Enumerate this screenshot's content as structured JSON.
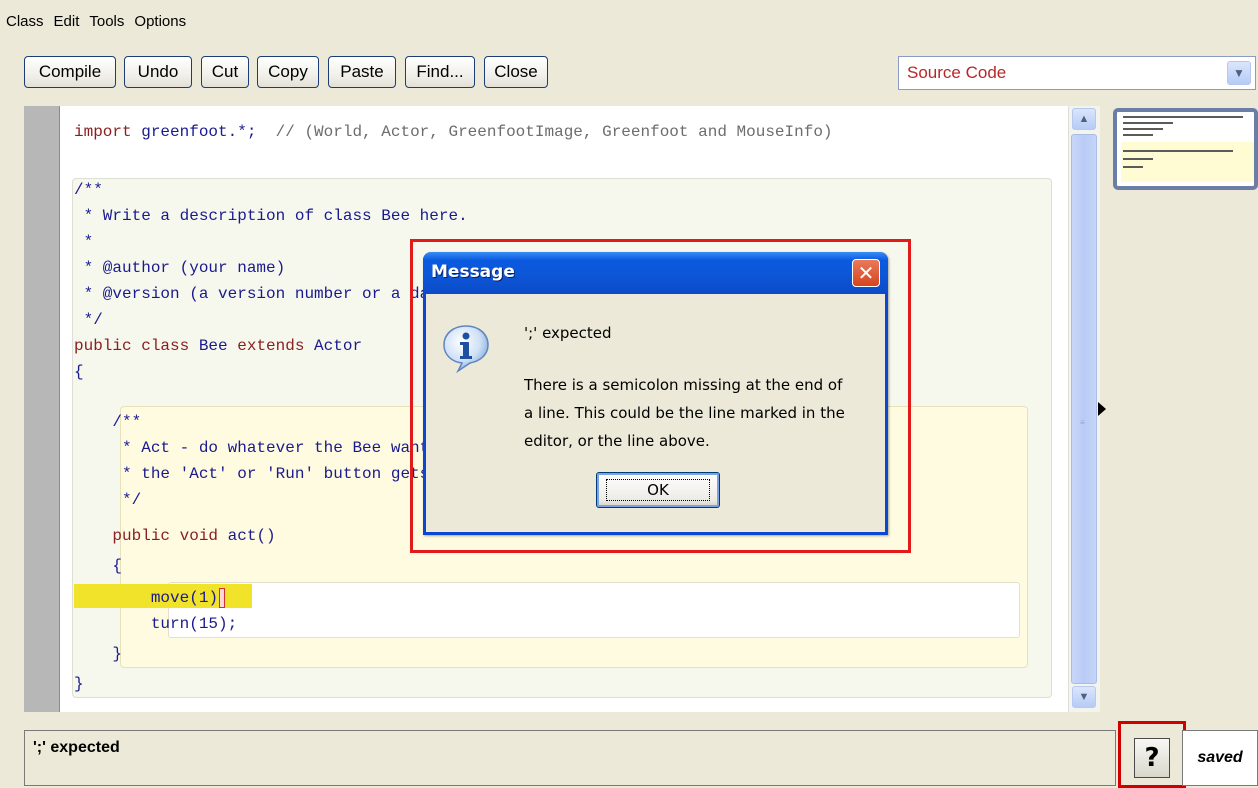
{
  "menu": [
    "Class",
    "Edit",
    "Tools",
    "Options"
  ],
  "toolbar": {
    "buttons": [
      "Compile",
      "Undo",
      "Cut",
      "Copy",
      "Paste",
      "Find...",
      "Close"
    ],
    "view_select": "Source Code"
  },
  "code_lines": [
    {
      "text": "import greenfoot.*;  // (World, Actor, GreenfootImage, Greenfoot and MouseInfo)"
    },
    {
      "text": "/**"
    },
    {
      "text": " * Write a description of class Bee here."
    },
    {
      "text": " *"
    },
    {
      "text": " * @author (your name)"
    },
    {
      "text": " * @version (a version number or a date)"
    },
    {
      "text": " */"
    },
    {
      "text": "public class Bee extends Actor"
    },
    {
      "text": "{"
    },
    {
      "text": "    /**"
    },
    {
      "text": "     * Act - do whatever the Bee wants to do. This method is called whenever"
    },
    {
      "text": "     * the 'Act' or 'Run' button gets pressed in the environment."
    },
    {
      "text": "     */"
    },
    {
      "text": "    public void act()"
    },
    {
      "text": "    {"
    },
    {
      "text": "        move(1)"
    },
    {
      "text": "        turn(15);"
    },
    {
      "text": "    }"
    },
    {
      "text": "}"
    }
  ],
  "dialog": {
    "title": "Message",
    "close_label": "✕",
    "message_heading": "';' expected",
    "message_lines": [
      "There is a semicolon missing at the end of",
      "a line. This could be the line marked in the",
      "editor, or the line above."
    ],
    "ok_label": "OK"
  },
  "status": {
    "message": "';' expected",
    "help_label": "?",
    "saved_label": "saved"
  },
  "colors": {
    "keyword": "#8a1e1e",
    "error_highlight": "#f0e32a",
    "annotation_border": "#e21a1a",
    "dialog_title": "#0b4bc8"
  }
}
